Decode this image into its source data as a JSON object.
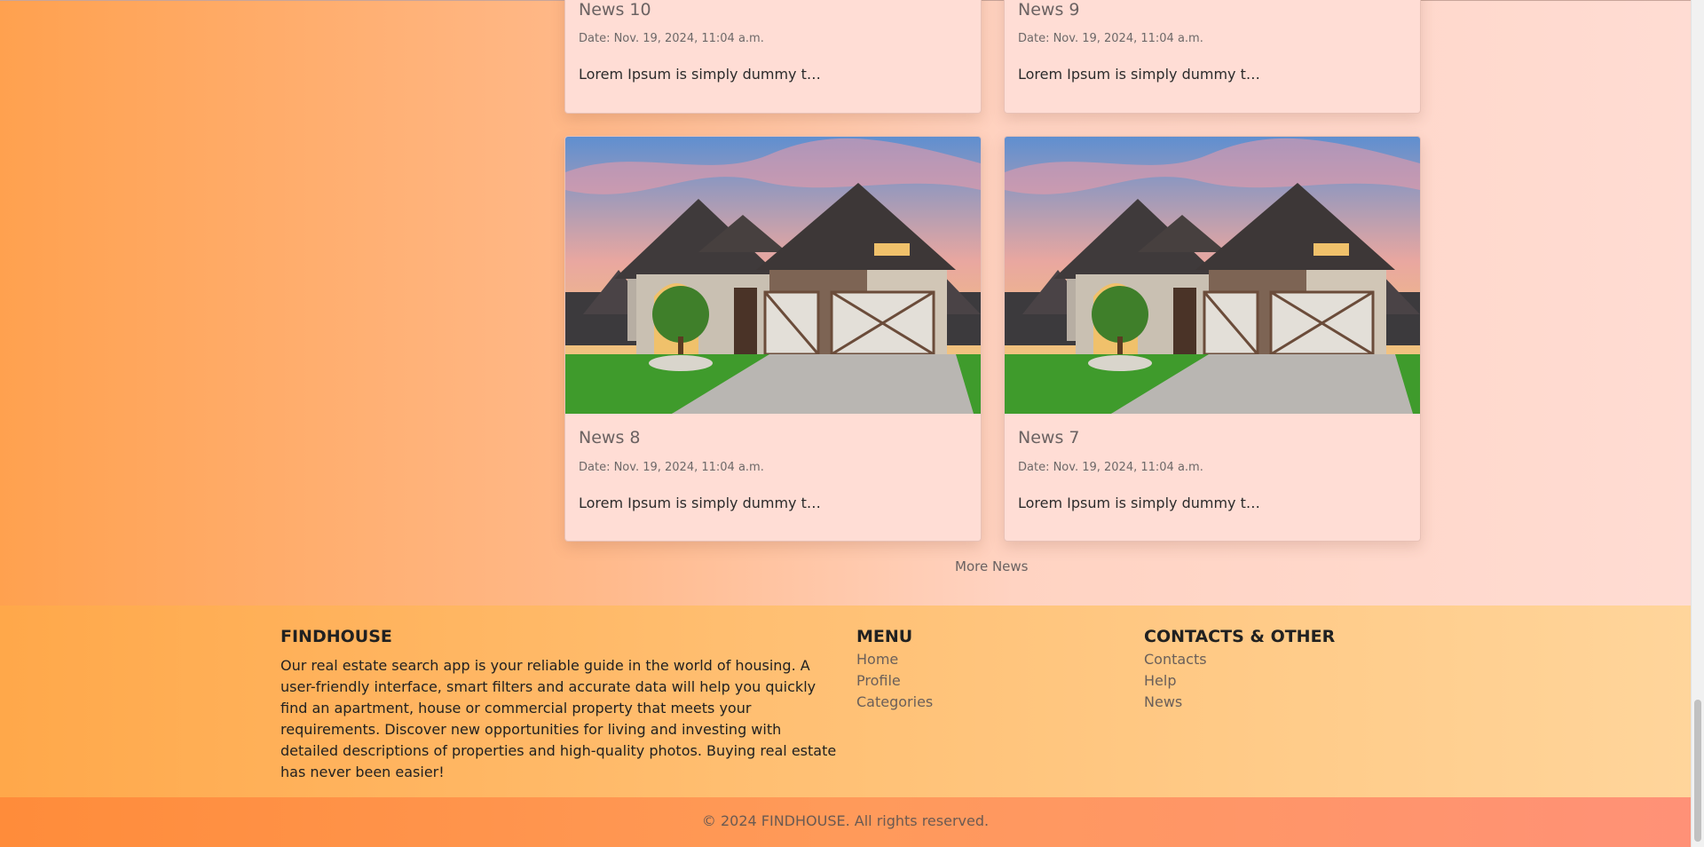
{
  "news_cards": [
    {
      "title": "News 10",
      "date": "Date: Nov. 19, 2024, 11:04 a.m.",
      "excerpt": "Lorem Ipsum is simply dummy t…"
    },
    {
      "title": "News 9",
      "date": "Date: Nov. 19, 2024, 11:04 a.m.",
      "excerpt": "Lorem Ipsum is simply dummy t…"
    },
    {
      "title": "News 8",
      "date": "Date: Nov. 19, 2024, 11:04 a.m.",
      "excerpt": "Lorem Ipsum is simply dummy t…"
    },
    {
      "title": "News 7",
      "date": "Date: Nov. 19, 2024, 11:04 a.m.",
      "excerpt": "Lorem Ipsum is simply dummy t…"
    }
  ],
  "more_news_label": "More News",
  "footer": {
    "brand": "FINDHOUSE",
    "description": "Our real estate search app is your reliable guide in the world of housing. A user-friendly interface, smart filters and accurate data will help you quickly find an apartment, house or commercial property that meets your requirements. Discover new opportunities for living and investing with detailed descriptions of properties and high-quality photos. Buying real estate has never been easier!",
    "menu_title": "MENU",
    "menu_items": [
      "Home",
      "Profile",
      "Categories"
    ],
    "contacts_title": "CONTACTS & OTHER",
    "contacts_items": [
      "Contacts",
      "Help",
      "News"
    ],
    "copyright": "© 2024 FINDHOUSE. All rights reserved."
  },
  "colors": {
    "card_bg": "#ffddd5",
    "footer_accent": "#ffbf72",
    "bottom_bar": "#ff9a5a"
  }
}
